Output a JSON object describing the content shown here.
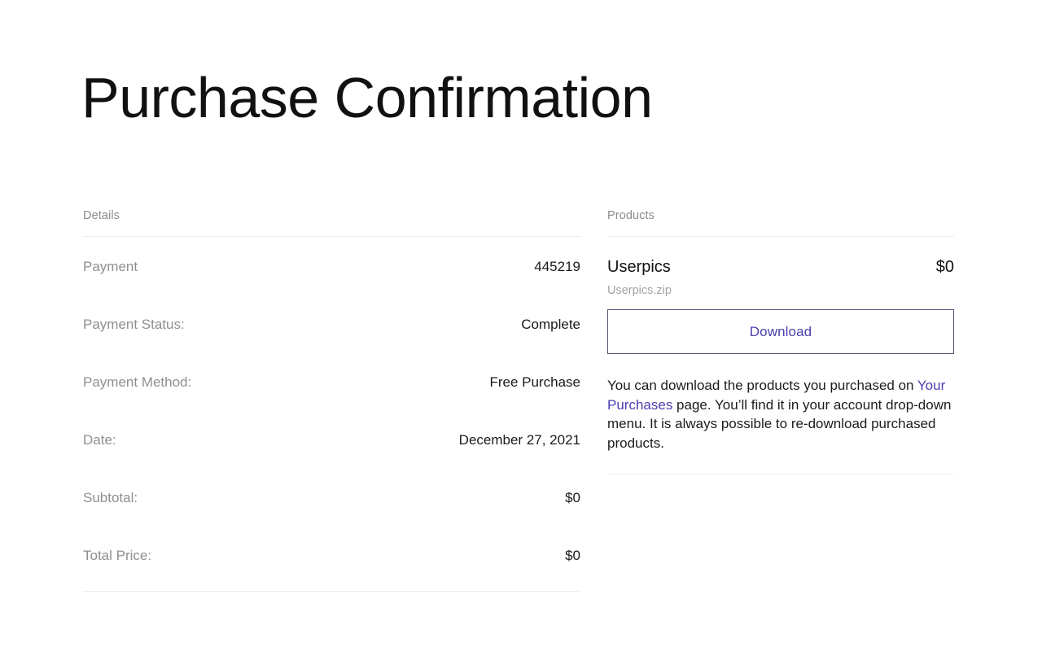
{
  "page": {
    "title": "Purchase Confirmation",
    "background_color": "#ffffff",
    "accent_color": "#4b3fb0",
    "muted_text_color": "#8f8f8f",
    "divider_color": "#ededed"
  },
  "details": {
    "section_label": "Details",
    "rows": [
      {
        "label": "Payment",
        "value": "445219"
      },
      {
        "label": "Payment Status:",
        "value": "Complete"
      },
      {
        "label": "Payment Method:",
        "value": "Free Purchase"
      },
      {
        "label": "Date:",
        "value": "December 27, 2021"
      },
      {
        "label": "Subtotal:",
        "value": "$0"
      },
      {
        "label": "Total Price:",
        "value": "$0"
      }
    ]
  },
  "products": {
    "section_label": "Products",
    "item": {
      "name": "Userpics",
      "price": "$0",
      "filename": "Userpics.zip",
      "download_label": "Download"
    },
    "note": {
      "part1": "You can download the products you purchased on ",
      "link": "Your Purchases",
      "part2": " page. You’ll find it in your account drop-down menu. It is always possible to re-download purchased products."
    }
  }
}
